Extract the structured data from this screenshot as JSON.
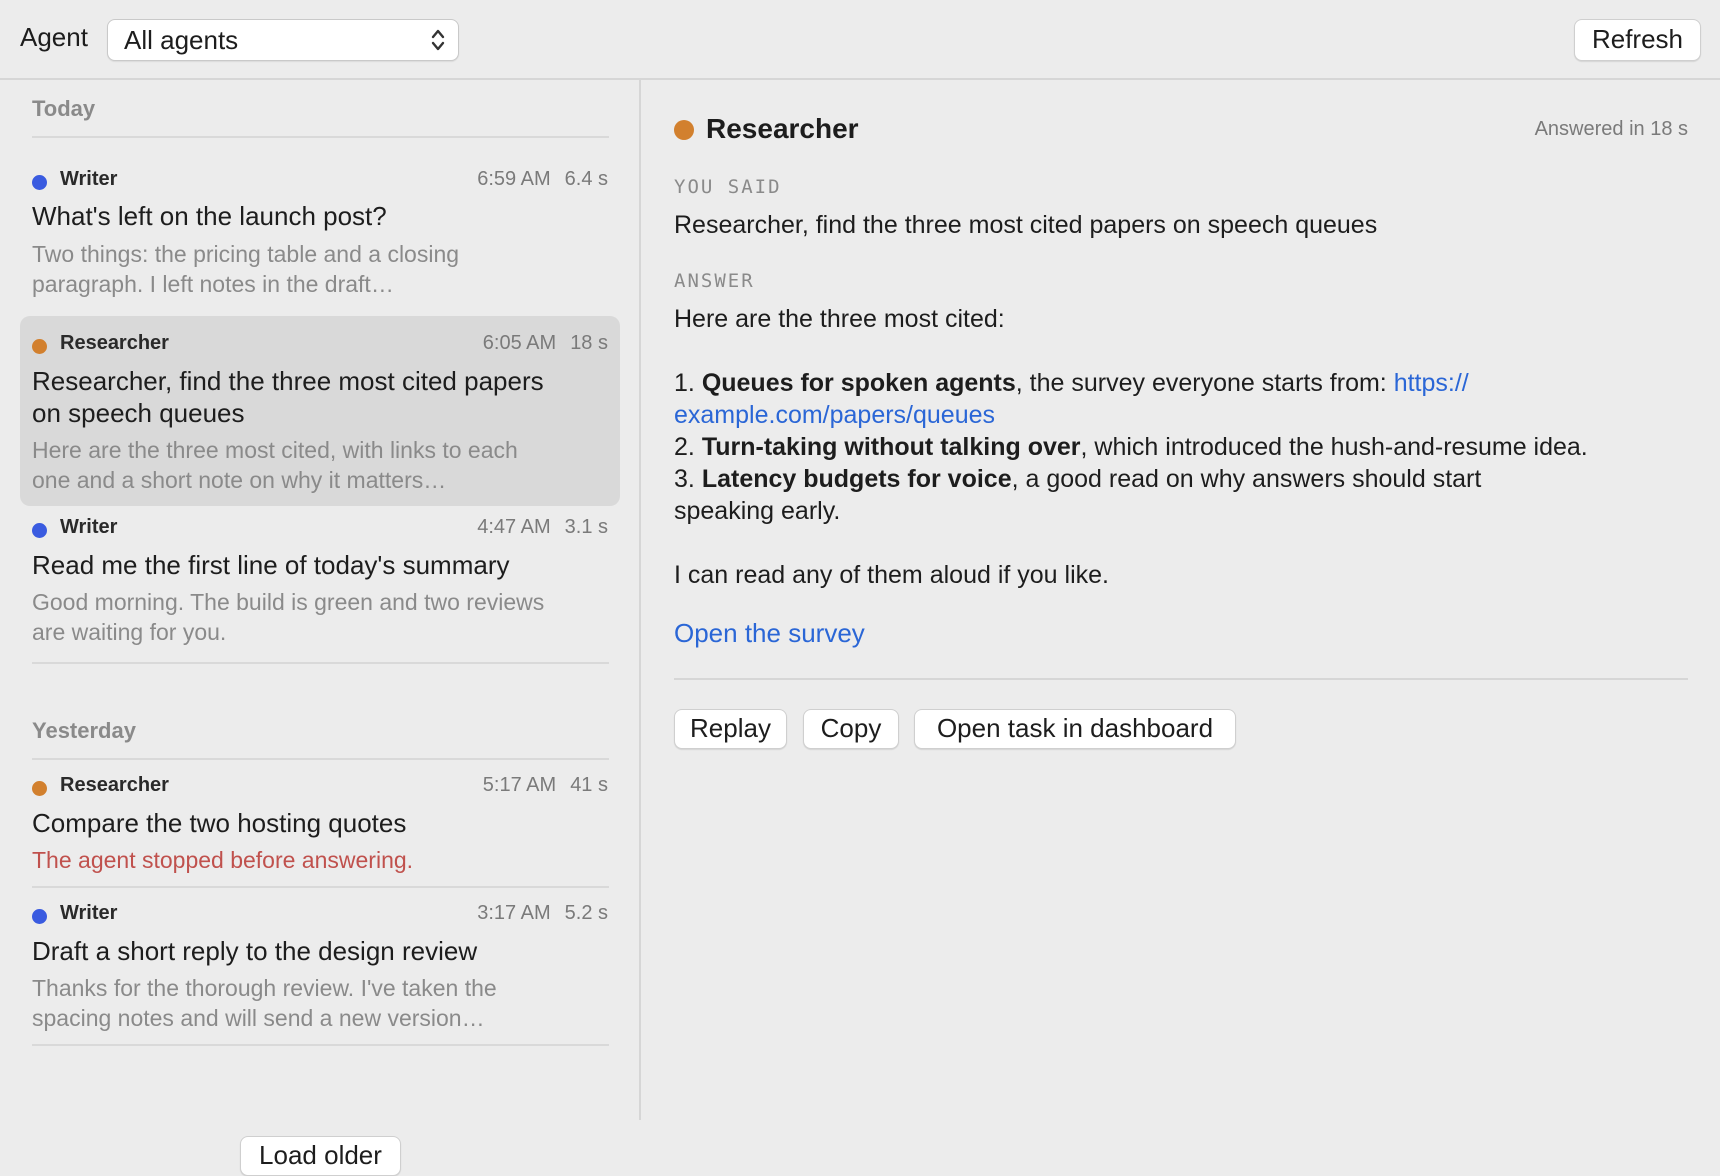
{
  "toolbar": {
    "agent_label": "Agent",
    "agent_select_value": "All agents",
    "refresh_label": "Refresh"
  },
  "sidebar": {
    "today_header": "Today",
    "yesterday_header": "Yesterday",
    "load_older_label": "Load older",
    "today_items": [
      {
        "agent": "Writer",
        "agent_color": "#3a5be0",
        "time": "6:59 AM",
        "duration": "6.4 s",
        "title": "What's left on the launch post?",
        "preview_1": "Two things: the pricing table and a closing",
        "preview_2": "paragraph. I left notes in the draft…"
      },
      {
        "agent": "Researcher",
        "agent_color": "#d2802e",
        "time": "6:05 AM",
        "duration": "18 s",
        "title_1": "Researcher, find the three most cited papers",
        "title_2": "on speech queues",
        "preview_1": "Here are the three most cited, with links to each",
        "preview_2": "one and a short note on why it matters…",
        "selected": true
      },
      {
        "agent": "Writer",
        "agent_color": "#3a5be0",
        "time": "4:47 AM",
        "duration": "3.1 s",
        "title": "Read me the first line of today's summary",
        "preview_1": "Good morning. The build is green and two reviews",
        "preview_2": "are waiting for you."
      }
    ],
    "yesterday_items": [
      {
        "agent": "Researcher",
        "agent_color": "#d2802e",
        "time": "5:17 AM",
        "duration": "41 s",
        "title": "Compare the two hosting quotes",
        "preview_1": "The agent stopped before answering.",
        "error": true
      },
      {
        "agent": "Writer",
        "agent_color": "#3a5be0",
        "time": "3:17 AM",
        "duration": "5.2 s",
        "title": "Draft a short reply to the design review",
        "preview_1": "Thanks for the thorough review. I've taken the",
        "preview_2": "spacing notes and will send a new version…"
      }
    ]
  },
  "detail": {
    "agent": "Researcher",
    "agent_color": "#d2802e",
    "answered": "Answered in 18 s",
    "you_said_label": "YOU SAID",
    "you_said": "Researcher, find the three most cited papers on speech queues",
    "answer_label": "ANSWER",
    "answer_intro": "Here are the three most cited:",
    "list": [
      {
        "num": "1.",
        "bold": "Queues for spoken agents",
        "rest": ", the survey everyone starts from: ",
        "link_1": "https://",
        "link_2": "example.com/papers/queues"
      },
      {
        "num": "2.",
        "bold": "Turn-taking without talking over",
        "rest": ", which introduced the hush-and-resume idea."
      },
      {
        "num": "3.",
        "bold": "Latency budgets for voice",
        "rest": ", a good read on why answers should start",
        "rest_2": "speaking early."
      }
    ],
    "closing": "I can read any of them aloud if you like.",
    "open_survey": "Open the survey",
    "buttons": {
      "replay": "Replay",
      "copy": "Copy",
      "dashboard": "Open task in dashboard"
    }
  }
}
